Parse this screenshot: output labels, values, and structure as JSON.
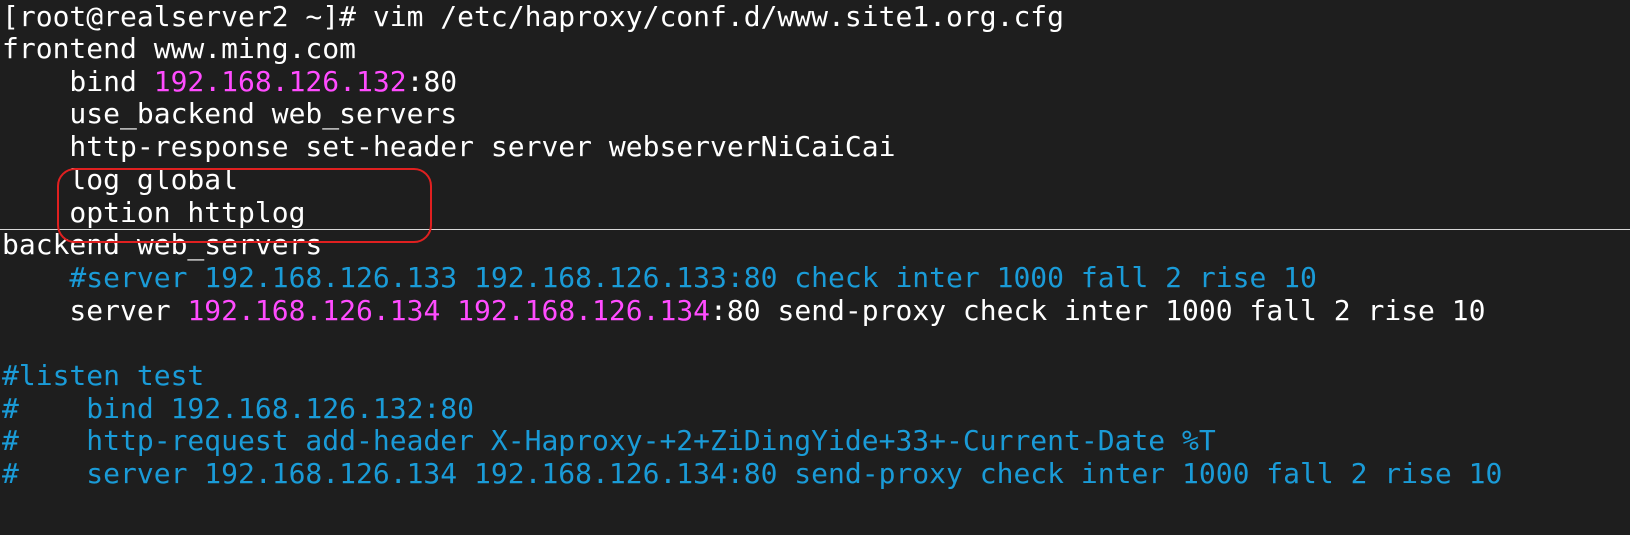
{
  "terminal": {
    "prompt_line": "[root@realserver2 ~]# vim /etc/haproxy/conf.d/www.site1.org.cfg",
    "lines": [
      [
        {
          "t": "frontend www.ming.com",
          "c": "white"
        }
      ],
      [
        {
          "t": "    bind ",
          "c": "white"
        },
        {
          "t": "192.168.126.132",
          "c": "magenta"
        },
        {
          "t": ":80",
          "c": "white"
        }
      ],
      [
        {
          "t": "    use_backend web_servers",
          "c": "white"
        }
      ],
      [
        {
          "t": "    http-response set-header server webserverNiCaiCai",
          "c": "white"
        }
      ],
      [
        {
          "t": "    log global",
          "c": "white"
        }
      ],
      [
        {
          "t": "    option httplog",
          "c": "white"
        }
      ],
      [
        {
          "t": "backend web_servers",
          "c": "white"
        }
      ],
      [
        {
          "t": "    #server 192.168.126.133 192.168.126.133:80 check inter 1000 fall 2 rise 10",
          "c": "comment"
        }
      ],
      [
        {
          "t": "    server ",
          "c": "white"
        },
        {
          "t": "192.168.126.134",
          "c": "magenta"
        },
        {
          "t": " ",
          "c": "white"
        },
        {
          "t": "192.168.126.134",
          "c": "magenta"
        },
        {
          "t": ":80 send-proxy check inter 1000 fall 2 rise 10",
          "c": "white"
        }
      ],
      [
        {
          "t": "",
          "c": "white"
        }
      ],
      [
        {
          "t": "#listen test",
          "c": "comment"
        }
      ],
      [
        {
          "t": "#    bind 192.168.126.132:80",
          "c": "comment"
        }
      ],
      [
        {
          "t": "#    http-request add-header X-Haproxy-+2+ZiDingYide+33+-Current-Date %T",
          "c": "comment"
        }
      ],
      [
        {
          "t": "#    server 192.168.126.134 192.168.126.134:80 send-proxy check inter 1000 fall 2 rise 10",
          "c": "comment"
        }
      ]
    ]
  },
  "colors": {
    "background": "#1e1e1e",
    "text": "#ffffff",
    "ip_highlight": "#ff4cff",
    "comment": "#1a9bd7",
    "annotation_box": "#e02020"
  }
}
